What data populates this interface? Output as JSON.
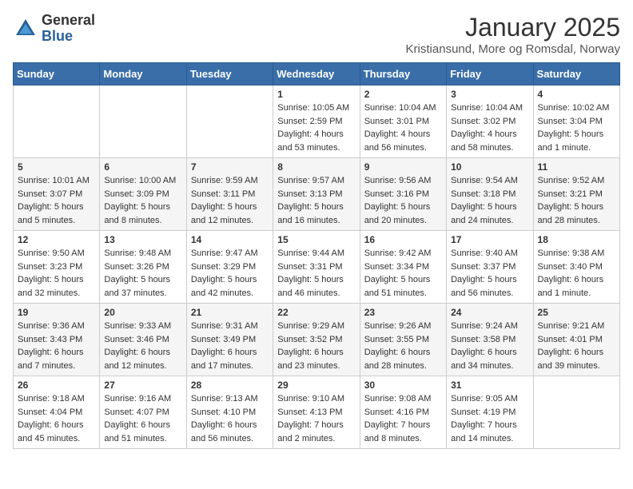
{
  "header": {
    "logo_general": "General",
    "logo_blue": "Blue",
    "month_title": "January 2025",
    "subtitle": "Kristiansund, More og Romsdal, Norway"
  },
  "days_of_week": [
    "Sunday",
    "Monday",
    "Tuesday",
    "Wednesday",
    "Thursday",
    "Friday",
    "Saturday"
  ],
  "weeks": [
    [
      {
        "day": "",
        "sunrise": "",
        "sunset": "",
        "daylight": ""
      },
      {
        "day": "",
        "sunrise": "",
        "sunset": "",
        "daylight": ""
      },
      {
        "day": "",
        "sunrise": "",
        "sunset": "",
        "daylight": ""
      },
      {
        "day": "1",
        "sunrise": "Sunrise: 10:05 AM",
        "sunset": "Sunset: 2:59 PM",
        "daylight": "Daylight: 4 hours and 53 minutes."
      },
      {
        "day": "2",
        "sunrise": "Sunrise: 10:04 AM",
        "sunset": "Sunset: 3:01 PM",
        "daylight": "Daylight: 4 hours and 56 minutes."
      },
      {
        "day": "3",
        "sunrise": "Sunrise: 10:04 AM",
        "sunset": "Sunset: 3:02 PM",
        "daylight": "Daylight: 4 hours and 58 minutes."
      },
      {
        "day": "4",
        "sunrise": "Sunrise: 10:02 AM",
        "sunset": "Sunset: 3:04 PM",
        "daylight": "Daylight: 5 hours and 1 minute."
      }
    ],
    [
      {
        "day": "5",
        "sunrise": "Sunrise: 10:01 AM",
        "sunset": "Sunset: 3:07 PM",
        "daylight": "Daylight: 5 hours and 5 minutes."
      },
      {
        "day": "6",
        "sunrise": "Sunrise: 10:00 AM",
        "sunset": "Sunset: 3:09 PM",
        "daylight": "Daylight: 5 hours and 8 minutes."
      },
      {
        "day": "7",
        "sunrise": "Sunrise: 9:59 AM",
        "sunset": "Sunset: 3:11 PM",
        "daylight": "Daylight: 5 hours and 12 minutes."
      },
      {
        "day": "8",
        "sunrise": "Sunrise: 9:57 AM",
        "sunset": "Sunset: 3:13 PM",
        "daylight": "Daylight: 5 hours and 16 minutes."
      },
      {
        "day": "9",
        "sunrise": "Sunrise: 9:56 AM",
        "sunset": "Sunset: 3:16 PM",
        "daylight": "Daylight: 5 hours and 20 minutes."
      },
      {
        "day": "10",
        "sunrise": "Sunrise: 9:54 AM",
        "sunset": "Sunset: 3:18 PM",
        "daylight": "Daylight: 5 hours and 24 minutes."
      },
      {
        "day": "11",
        "sunrise": "Sunrise: 9:52 AM",
        "sunset": "Sunset: 3:21 PM",
        "daylight": "Daylight: 5 hours and 28 minutes."
      }
    ],
    [
      {
        "day": "12",
        "sunrise": "Sunrise: 9:50 AM",
        "sunset": "Sunset: 3:23 PM",
        "daylight": "Daylight: 5 hours and 32 minutes."
      },
      {
        "day": "13",
        "sunrise": "Sunrise: 9:48 AM",
        "sunset": "Sunset: 3:26 PM",
        "daylight": "Daylight: 5 hours and 37 minutes."
      },
      {
        "day": "14",
        "sunrise": "Sunrise: 9:47 AM",
        "sunset": "Sunset: 3:29 PM",
        "daylight": "Daylight: 5 hours and 42 minutes."
      },
      {
        "day": "15",
        "sunrise": "Sunrise: 9:44 AM",
        "sunset": "Sunset: 3:31 PM",
        "daylight": "Daylight: 5 hours and 46 minutes."
      },
      {
        "day": "16",
        "sunrise": "Sunrise: 9:42 AM",
        "sunset": "Sunset: 3:34 PM",
        "daylight": "Daylight: 5 hours and 51 minutes."
      },
      {
        "day": "17",
        "sunrise": "Sunrise: 9:40 AM",
        "sunset": "Sunset: 3:37 PM",
        "daylight": "Daylight: 5 hours and 56 minutes."
      },
      {
        "day": "18",
        "sunrise": "Sunrise: 9:38 AM",
        "sunset": "Sunset: 3:40 PM",
        "daylight": "Daylight: 6 hours and 1 minute."
      }
    ],
    [
      {
        "day": "19",
        "sunrise": "Sunrise: 9:36 AM",
        "sunset": "Sunset: 3:43 PM",
        "daylight": "Daylight: 6 hours and 7 minutes."
      },
      {
        "day": "20",
        "sunrise": "Sunrise: 9:33 AM",
        "sunset": "Sunset: 3:46 PM",
        "daylight": "Daylight: 6 hours and 12 minutes."
      },
      {
        "day": "21",
        "sunrise": "Sunrise: 9:31 AM",
        "sunset": "Sunset: 3:49 PM",
        "daylight": "Daylight: 6 hours and 17 minutes."
      },
      {
        "day": "22",
        "sunrise": "Sunrise: 9:29 AM",
        "sunset": "Sunset: 3:52 PM",
        "daylight": "Daylight: 6 hours and 23 minutes."
      },
      {
        "day": "23",
        "sunrise": "Sunrise: 9:26 AM",
        "sunset": "Sunset: 3:55 PM",
        "daylight": "Daylight: 6 hours and 28 minutes."
      },
      {
        "day": "24",
        "sunrise": "Sunrise: 9:24 AM",
        "sunset": "Sunset: 3:58 PM",
        "daylight": "Daylight: 6 hours and 34 minutes."
      },
      {
        "day": "25",
        "sunrise": "Sunrise: 9:21 AM",
        "sunset": "Sunset: 4:01 PM",
        "daylight": "Daylight: 6 hours and 39 minutes."
      }
    ],
    [
      {
        "day": "26",
        "sunrise": "Sunrise: 9:18 AM",
        "sunset": "Sunset: 4:04 PM",
        "daylight": "Daylight: 6 hours and 45 minutes."
      },
      {
        "day": "27",
        "sunrise": "Sunrise: 9:16 AM",
        "sunset": "Sunset: 4:07 PM",
        "daylight": "Daylight: 6 hours and 51 minutes."
      },
      {
        "day": "28",
        "sunrise": "Sunrise: 9:13 AM",
        "sunset": "Sunset: 4:10 PM",
        "daylight": "Daylight: 6 hours and 56 minutes."
      },
      {
        "day": "29",
        "sunrise": "Sunrise: 9:10 AM",
        "sunset": "Sunset: 4:13 PM",
        "daylight": "Daylight: 7 hours and 2 minutes."
      },
      {
        "day": "30",
        "sunrise": "Sunrise: 9:08 AM",
        "sunset": "Sunset: 4:16 PM",
        "daylight": "Daylight: 7 hours and 8 minutes."
      },
      {
        "day": "31",
        "sunrise": "Sunrise: 9:05 AM",
        "sunset": "Sunset: 4:19 PM",
        "daylight": "Daylight: 7 hours and 14 minutes."
      },
      {
        "day": "",
        "sunrise": "",
        "sunset": "",
        "daylight": ""
      }
    ]
  ]
}
